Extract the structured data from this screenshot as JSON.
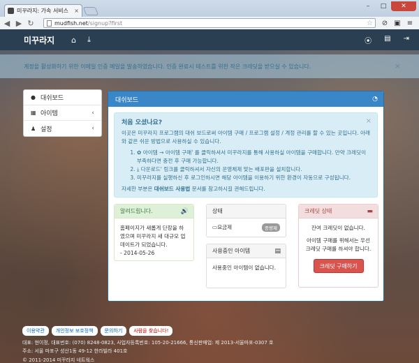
{
  "browser": {
    "tab_title": "미꾸라지: 가속 서비스",
    "tab_close": "×",
    "url_host": "mudfish.net",
    "url_path": "/signup?first",
    "minimize": "–",
    "maximize": "□",
    "close": "✕"
  },
  "navbar": {
    "brand": "미꾸라지"
  },
  "alert": {
    "text": "계정을 활성화하기 위한 이메일 인증 메일을 발송하였습니다. 인증 완료시 테스트를 위한 작은 크레딧을 받으실 수 있습니다.",
    "close": "×"
  },
  "sidebar": {
    "items": [
      {
        "label": "대쉬보드",
        "icon": "info-circle-icon"
      },
      {
        "label": "아이템",
        "icon": "th-large-icon",
        "chevron": "‹"
      },
      {
        "label": "설정",
        "icon": "user-icon",
        "chevron": "‹"
      }
    ]
  },
  "panel": {
    "title": "대쉬보드",
    "welcome": {
      "heading": "처음 오셨나요?",
      "close": "×",
      "intro": "이곳은 미꾸라지 프로그램의 대쉬 보드로써 아이템 구매 / 프로그램 설정 / 계정 관리를 할 수 있는 곳입니다. 아래와 같은 쉬운 방법으로 사용하실 수 있습니다.",
      "steps": [
        "아이템 → 아이템 구매' 를 클릭하셔서 미꾸라지를 통해 사용하실 아이템을 구매합니다. 만약 크레딧이 부족하다면 충전 후 구매 가능합니다.",
        "다운로드' 링크를 클릭하셔서 자신의 운영체제 맞는 배포판을 설치합니다.",
        "미꾸라지를 실행하신 후 로그인하시면 해당 아이템을 이용하기 위한 환경이 자동으로 구성됩니다."
      ],
      "outro_pre": "자세한 부분은 ",
      "outro_bold": "대쉬보드 사용법",
      "outro_post": " 문서를 참고하시길 권해드립니다."
    },
    "notice": {
      "title": "알려드립니다.",
      "body": "홈페이지가 새롭게 단장을 하였으며 미꾸라지 새 대규모 업데이트가 되었습니다.",
      "date": "- 2014-05-26"
    },
    "status": {
      "title": "상태",
      "row_label": "요금제",
      "badge": "종량제"
    },
    "using": {
      "title": "사용중인 아이템",
      "body": "사용중인 아이템이 없습니다."
    },
    "credit": {
      "title": "크레딧 상태",
      "line1": "잔여 크레딧이 없습니다.",
      "line2": "아이템 구매를 위해서는 우선 크레딧 구매를 하셔야 합니다.",
      "button": "크레딧 구매하기"
    }
  },
  "footer": {
    "links": [
      "이용약관",
      "개인정보 보호정책",
      "문의하기",
      "사람을 찾습니다!"
    ],
    "line1": "대표: 현이정, 대표번호: (070) 8248-0823, 사업자등록번호: 105-20-21666, 통신판매업: 제 2013-서울마포-0307 호",
    "line2": "주소: 서울 마포구 성산1동 49-12 한라빌라 401호",
    "line3": "© 2011-2014 미꾸라지 네트웍스"
  }
}
